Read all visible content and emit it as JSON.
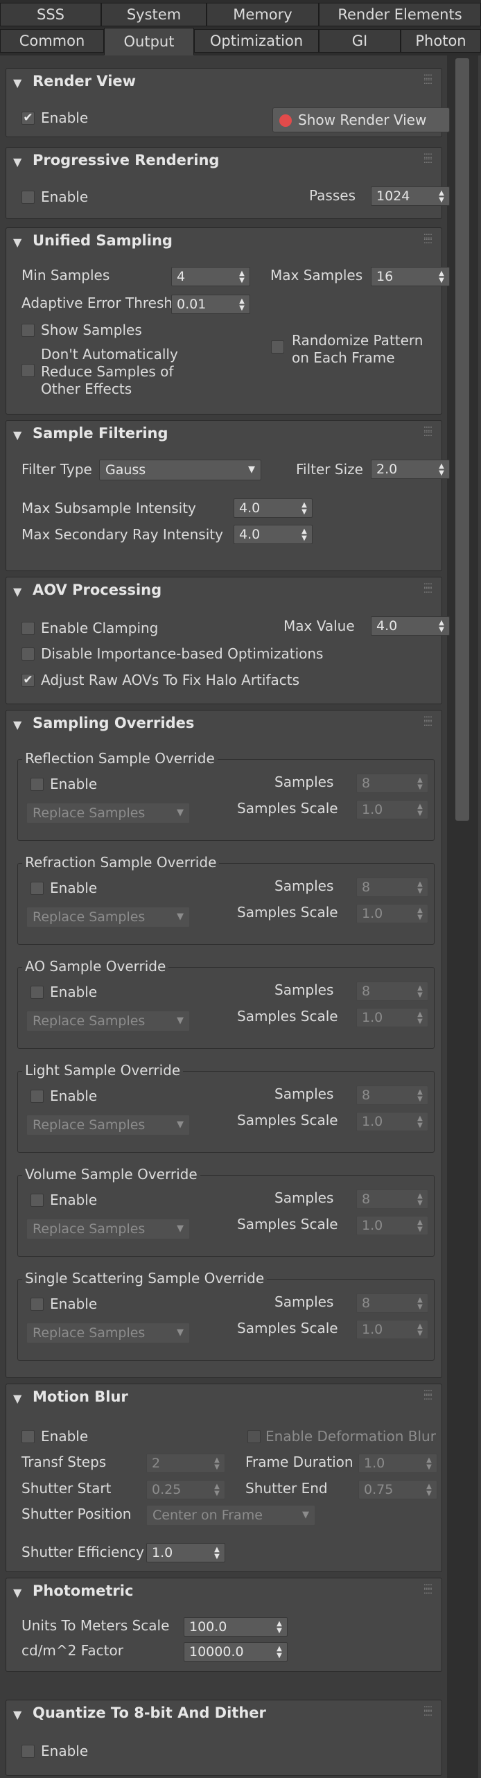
{
  "tabs": {
    "row1": [
      "SSS",
      "System",
      "Memory",
      "Render Elements"
    ],
    "row2": [
      "Common",
      "Output",
      "Optimization",
      "GI",
      "Photon"
    ],
    "active": "Output"
  },
  "render_view": {
    "title": "Render View",
    "enable_label": "Enable",
    "enable_checked": true,
    "show_button": "Show Render View",
    "button_dot_color": "#e24b4b"
  },
  "progressive": {
    "title": "Progressive Rendering",
    "enable_label": "Enable",
    "passes_label": "Passes",
    "passes_value": "1024"
  },
  "unified": {
    "title": "Unified Sampling",
    "min_label": "Min Samples",
    "min_value": "4",
    "max_label": "Max Samples",
    "max_value": "16",
    "adaptive_label": "Adaptive Error Thresh",
    "adaptive_value": "0.01",
    "show_samples_label": "Show Samples",
    "dont_reduce_l1": "Don't Automatically",
    "dont_reduce_l2": "Reduce Samples of",
    "dont_reduce_l3": "Other Effects",
    "randomize_l1": "Randomize Pattern",
    "randomize_l2": "on Each Frame"
  },
  "filtering": {
    "title": "Sample Filtering",
    "filter_type_label": "Filter Type",
    "filter_type_value": "Gauss",
    "filter_size_label": "Filter Size",
    "filter_size_value": "2.0",
    "max_sub_label": "Max Subsample Intensity",
    "max_sub_value": "4.0",
    "max_sec_label": "Max Secondary Ray Intensity",
    "max_sec_value": "4.0"
  },
  "aov": {
    "title": "AOV Processing",
    "clamp_label": "Enable Clamping",
    "max_value_label": "Max Value",
    "max_value": "4.0",
    "disable_importance_label": "Disable Importance-based Optimizations",
    "adjust_raw_label": "Adjust Raw AOVs To Fix Halo Artifacts",
    "adjust_raw_checked": true
  },
  "overrides": {
    "title": "Sampling Overrides",
    "enable_label": "Enable",
    "samples_label": "Samples",
    "scale_label": "Samples Scale",
    "mode_value": "Replace Samples",
    "groups": [
      {
        "title": "Reflection Sample Override",
        "samples": "8",
        "scale": "1.0"
      },
      {
        "title": "Refraction Sample Override",
        "samples": "8",
        "scale": "1.0"
      },
      {
        "title": "AO Sample Override",
        "samples": "8",
        "scale": "1.0"
      },
      {
        "title": "Light Sample Override",
        "samples": "8",
        "scale": "1.0"
      },
      {
        "title": "Volume Sample Override",
        "samples": "8",
        "scale": "1.0"
      },
      {
        "title": "Single Scattering Sample Override",
        "samples": "8",
        "scale": "1.0"
      }
    ]
  },
  "motion_blur": {
    "title": "Motion Blur",
    "enable_label": "Enable",
    "deform_label": "Enable Deformation Blur",
    "transf_label": "Transf Steps",
    "transf_value": "2",
    "frame_dur_label": "Frame Duration",
    "frame_dur_value": "1.0",
    "shutter_start_label": "Shutter Start",
    "shutter_start_value": "0.25",
    "shutter_end_label": "Shutter End",
    "shutter_end_value": "0.75",
    "shutter_pos_label": "Shutter Position",
    "shutter_pos_value": "Center on Frame",
    "shutter_eff_label": "Shutter Efficiency",
    "shutter_eff_value": "1.0"
  },
  "photometric": {
    "title": "Photometric",
    "units_label": "Units To Meters Scale",
    "units_value": "100.0",
    "cdm_label": "cd/m^2 Factor",
    "cdm_value": "10000.0"
  },
  "quantize": {
    "title": "Quantize To 8-bit And Dither",
    "enable_label": "Enable"
  }
}
